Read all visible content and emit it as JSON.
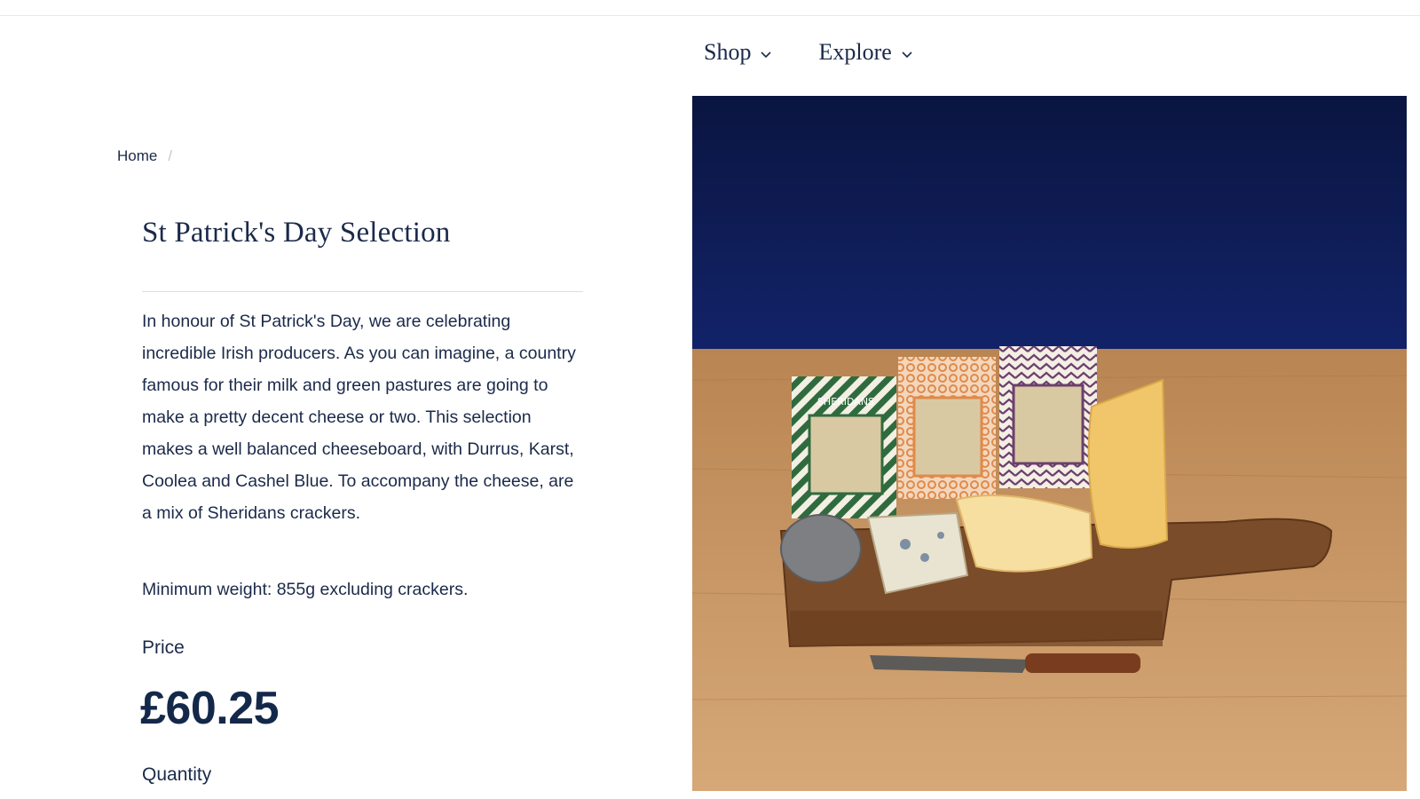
{
  "nav": {
    "items": [
      {
        "label": "Shop"
      },
      {
        "label": "Explore"
      }
    ]
  },
  "breadcrumb": {
    "home": "Home",
    "separator": "/"
  },
  "product": {
    "title": "St Patrick's Day Selection",
    "description": "In honour of St Patrick's Day, we are celebrating incredible Irish producers. As you can imagine, a country famous for their milk and green pastures are going to make a pretty decent cheese or two. This selection makes a well balanced cheeseboard, with Durrus, Karst, Coolea and Cashel Blue. To accompany the cheese, are a mix of Sheridans crackers.",
    "min_weight": "Minimum weight: 855g excluding crackers.",
    "price_label": "Price",
    "price": "£60.25",
    "quantity_label": "Quantity"
  },
  "image": {
    "subject": "cheeseboard-with-crackers-photo",
    "pack_brand": "SHERIDANS"
  },
  "colors": {
    "text": "#1b2a4a",
    "backdrop": "#0d1a4d",
    "table": "#c99a68",
    "board": "#8a5a32",
    "green": "#2f6b3e",
    "orange": "#e08a4a",
    "purple": "#6c3f6e"
  }
}
